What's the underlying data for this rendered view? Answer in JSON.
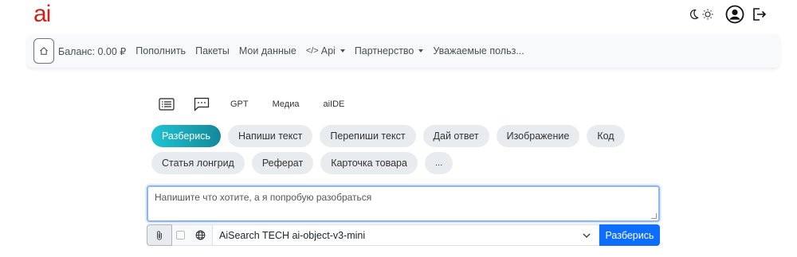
{
  "app": {
    "logo": "ai"
  },
  "header": {
    "icons": [
      "moon-icon",
      "sun-icon",
      "user-circle-icon",
      "logout-icon"
    ]
  },
  "navbar": {
    "items": [
      {
        "label": "Баланс: 0.00 ₽"
      },
      {
        "label": "Пополнить"
      },
      {
        "label": "Пакеты"
      },
      {
        "label": "Мои данные"
      },
      {
        "label": "Api",
        "prefix": "</>",
        "dropdown": true
      },
      {
        "label": "Партнерство",
        "dropdown": true
      },
      {
        "label": "Уважаемые польз..."
      }
    ]
  },
  "mode_tabs": {
    "gpt": "GPT",
    "media": "Медиа",
    "ide": "aiIDE"
  },
  "pills": {
    "row1": [
      "Разберись",
      "Напиши текст",
      "Перепиши текст",
      "Дай ответ",
      "Изображение",
      "Код"
    ],
    "row2": [
      "Статья лонгрид",
      "Реферат",
      "Карточка товара",
      "..."
    ],
    "active": "Разберись"
  },
  "prompt": {
    "placeholder": "Напишите что хотите, а я попробую разобраться"
  },
  "bottom_bar": {
    "model": "AiSearch TECH ai-object-v3-mini",
    "submit_label": "Разберись"
  },
  "colors": {
    "logo": "#d0201a",
    "active_pill_start": "#1fc4d4",
    "active_pill_end": "#12899a",
    "submit": "#0d6efd"
  }
}
